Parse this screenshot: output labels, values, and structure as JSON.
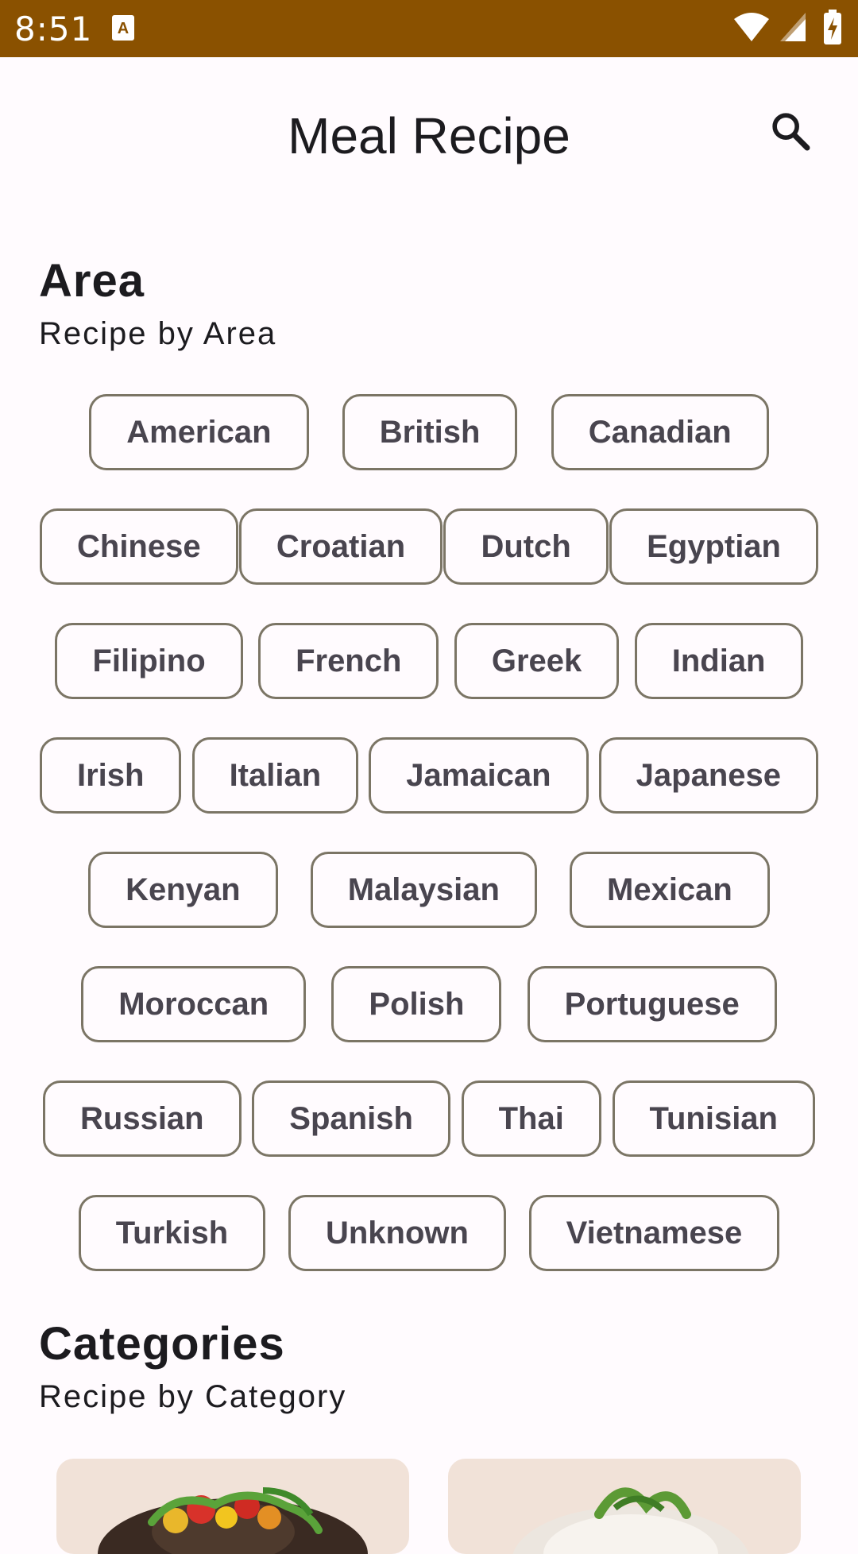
{
  "status_bar": {
    "time": "8:51",
    "background": "#8a5100"
  },
  "app_bar": {
    "title": "Meal Recipe",
    "search_icon": "search-icon"
  },
  "area": {
    "title": "Area",
    "subtitle": "Recipe by Area",
    "rows": [
      [
        "American",
        "British",
        "Canadian"
      ],
      [
        "Chinese",
        "Croatian",
        "Dutch",
        "Egyptian"
      ],
      [
        "Filipino",
        "French",
        "Greek",
        "Indian"
      ],
      [
        "Irish",
        "Italian",
        "Jamaican",
        "Japanese"
      ],
      [
        "Kenyan",
        "Malaysian",
        "Mexican"
      ],
      [
        "Moroccan",
        "Polish",
        "Portuguese"
      ],
      [
        "Russian",
        "Spanish",
        "Thai",
        "Tunisian"
      ],
      [
        "Turkish",
        "Unknown",
        "Vietnamese"
      ]
    ]
  },
  "categories": {
    "title": "Categories",
    "subtitle": "Recipe by Category"
  }
}
